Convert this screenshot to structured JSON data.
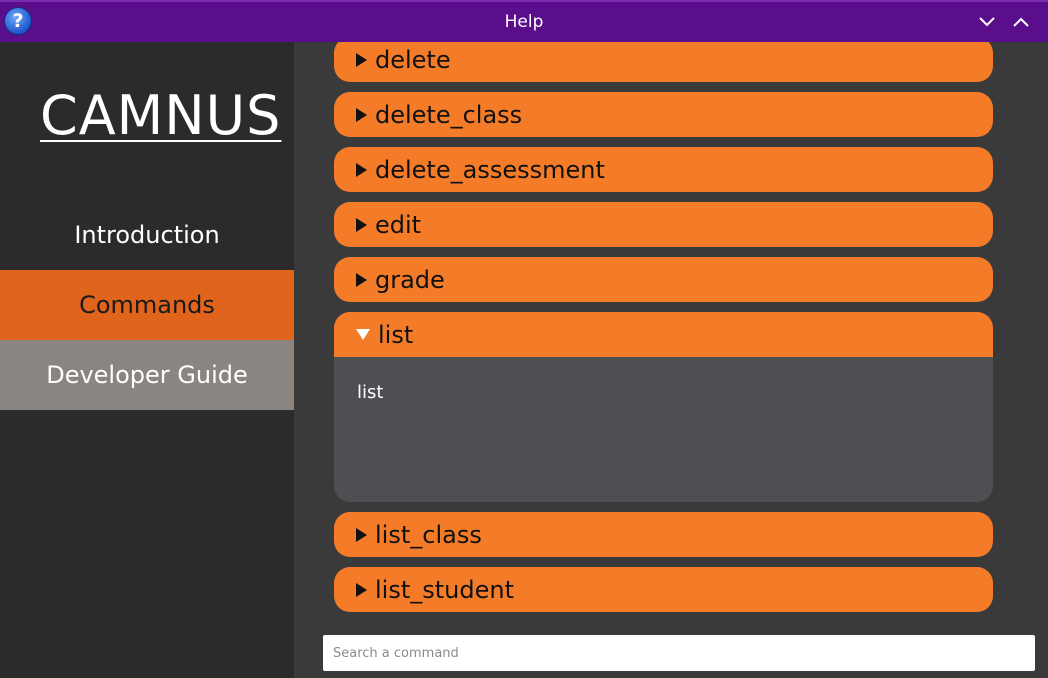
{
  "window": {
    "title": "Help",
    "help_icon": "?",
    "minimize_icon": "chevron-down-icon",
    "maximize_icon": "chevron-up-icon"
  },
  "sidebar": {
    "logo": "CAMNUS",
    "items": [
      {
        "label": "Introduction",
        "selected": false
      },
      {
        "label": "Commands",
        "selected": true
      },
      {
        "label": "Developer Guide",
        "selected": false
      }
    ]
  },
  "commands": [
    {
      "label": "delete",
      "expanded": false
    },
    {
      "label": "delete_class",
      "expanded": false
    },
    {
      "label": "delete_assessment",
      "expanded": false
    },
    {
      "label": "edit",
      "expanded": false
    },
    {
      "label": "grade",
      "expanded": false
    },
    {
      "label": "list",
      "expanded": true,
      "description": "list"
    },
    {
      "label": "list_class",
      "expanded": false
    },
    {
      "label": "list_student",
      "expanded": false
    }
  ],
  "search": {
    "placeholder": "Search a command",
    "value": ""
  },
  "colors": {
    "titlebar": "#5b0e8c",
    "accent": "#f47b28",
    "selected_nav": "#e0641b",
    "secondary_nav": "#8a8580",
    "sidebar_bg": "#2b2b2b",
    "main_bg": "#3a3a3a",
    "expanded_body": "#4d4f53"
  }
}
